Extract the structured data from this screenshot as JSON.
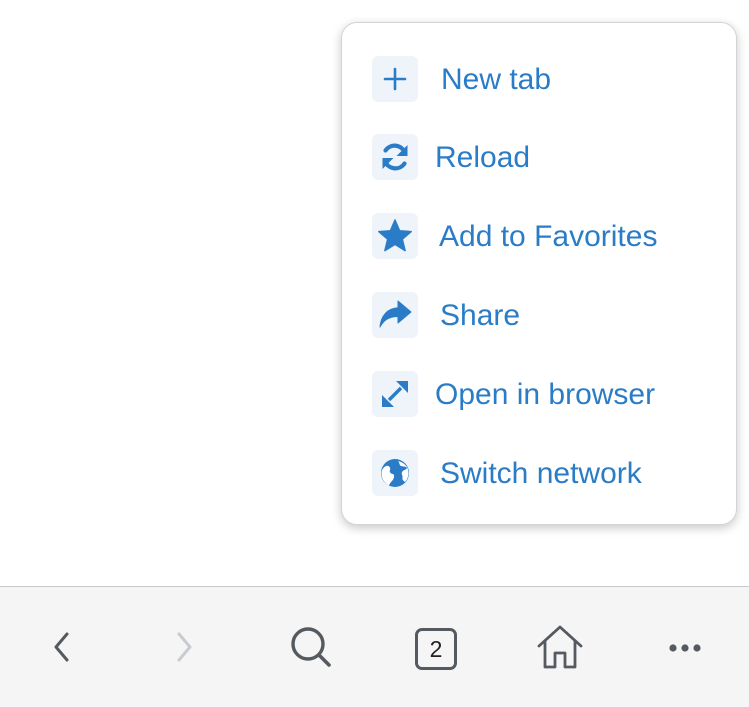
{
  "menu": {
    "items": [
      {
        "label": "New tab",
        "icon": "plus-icon"
      },
      {
        "label": "Reload",
        "icon": "reload-icon"
      },
      {
        "label": "Add to Favorites",
        "icon": "star-icon"
      },
      {
        "label": "Share",
        "icon": "share-icon"
      },
      {
        "label": "Open in browser",
        "icon": "expand-icon"
      },
      {
        "label": "Switch network",
        "icon": "globe-icon"
      }
    ]
  },
  "toolbar": {
    "tab_count": "2",
    "buttons": [
      "back-icon",
      "forward-icon",
      "search-icon",
      "tabs-icon",
      "home-icon",
      "more-icon"
    ]
  },
  "colors": {
    "accent": "#2a7cc7",
    "icon_bg": "#eef4fa",
    "toolbar_bg": "#f5f5f5",
    "toolbar_icon": "#555a60",
    "disabled_icon": "#c8ccd2"
  }
}
